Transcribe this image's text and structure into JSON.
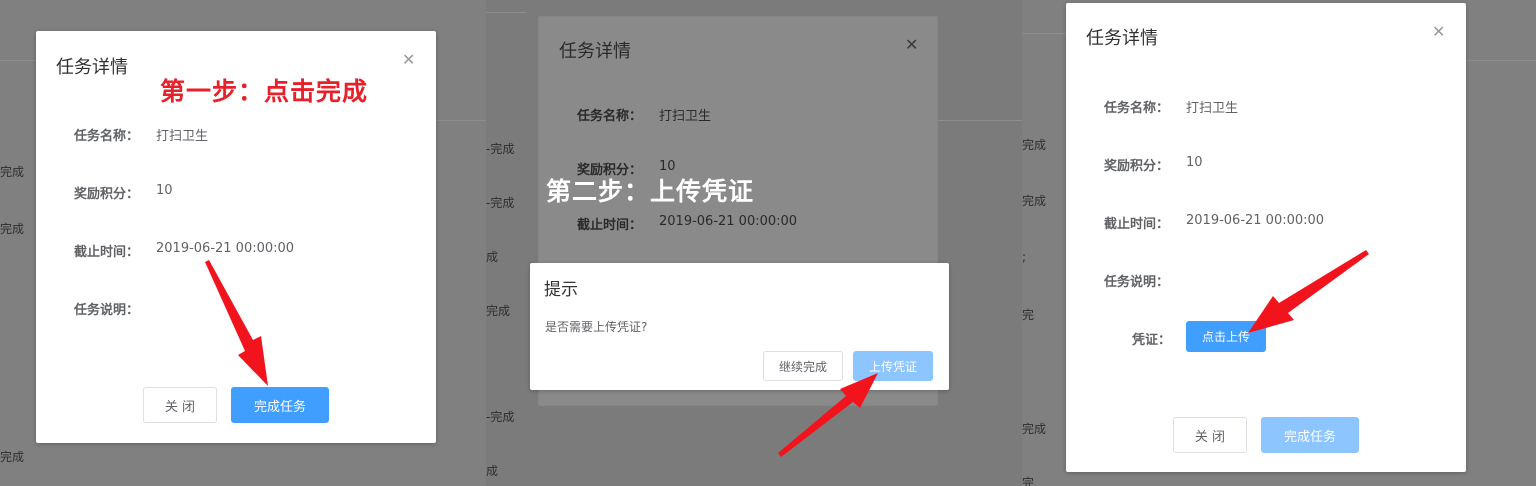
{
  "panel1": {
    "bg_rows": [
      "完成",
      "完成",
      "",
      "",
      "",
      "",
      "",
      "完成"
    ],
    "dialog": {
      "title": "任务详情",
      "fields": [
        {
          "label": "任务名称：",
          "value": "打扫卫生"
        },
        {
          "label": "奖励积分：",
          "value": "10"
        },
        {
          "label": "截止时间：",
          "value": "2019-06-21 00:00:00"
        },
        {
          "label": "任务说明：",
          "value": ""
        }
      ],
      "close_button": "关 闭",
      "complete_button": "完成任务"
    },
    "annotation": "第一步：点击完成"
  },
  "panel2": {
    "bg_rows": [
      "-完成",
      "-完成",
      "成",
      "完成",
      "",
      "-完成",
      "成"
    ],
    "dialog": {
      "title": "任务详情",
      "fields": [
        {
          "label": "任务名称：",
          "value": "打扫卫生"
        },
        {
          "label": "奖励积分：",
          "value": "10"
        },
        {
          "label": "截止时间：",
          "value": "2019-06-21 00:00:00"
        }
      ]
    },
    "prompt": {
      "title": "提示",
      "message": "是否需要上传凭证?",
      "continue_button": "继续完成",
      "upload_button": "上传凭证"
    },
    "annotation": "第二步：上传凭证"
  },
  "panel3": {
    "bg_rows": [
      "完成",
      "完成",
      ";",
      "完",
      "",
      "",
      "完成",
      "完"
    ],
    "dialog": {
      "title": "任务详情",
      "fields": [
        {
          "label": "任务名称：",
          "value": "打扫卫生"
        },
        {
          "label": "奖励积分：",
          "value": "10"
        },
        {
          "label": "截止时间：",
          "value": "2019-06-21 00:00:00"
        },
        {
          "label": "任务说明：",
          "value": ""
        }
      ],
      "voucher_label": "凭证：",
      "upload_button": "点击上传",
      "close_button": "关 闭",
      "complete_button": "完成任务"
    }
  },
  "colors": {
    "primary": "#409eff",
    "primary_light": "#8cc5ff",
    "annotation_red": "#e8202a",
    "arrow_red": "#f2141c"
  }
}
